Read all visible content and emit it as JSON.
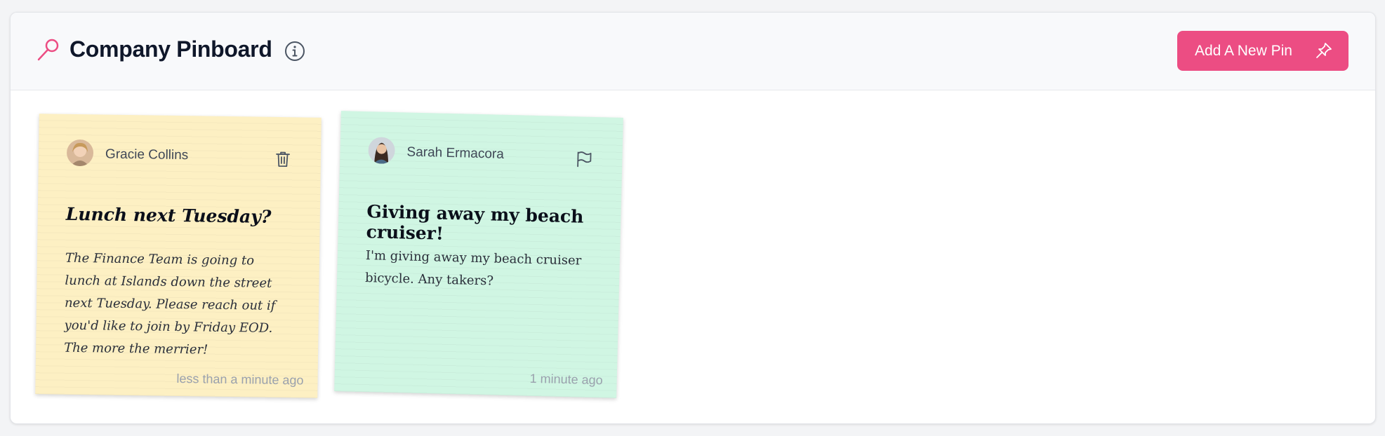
{
  "header": {
    "title": "Company Pinboard",
    "add_button_label": "Add A New Pin"
  },
  "icons": {
    "logo": "pin-icon",
    "info": "info-icon",
    "add_pin": "pushpin-icon",
    "delete": "trash-icon",
    "report": "flag-icon"
  },
  "colors": {
    "accent": "#ec4d83",
    "yellow_note": "#fdf0c3",
    "green_note": "#d0f6e3"
  },
  "notes": [
    {
      "author": "Gracie Collins",
      "title": "Lunch next Tuesday?",
      "body": "The Finance Team is going to lunch at Islands down the street next Tuesday. Please reach out if you'd like to join by Friday EOD. The more the merrier!",
      "time": "less than a minute ago",
      "action_icon": "trash-icon"
    },
    {
      "author": "Sarah Ermacora",
      "title": "Giving away my beach cruiser!",
      "body": "I'm giving away my beach cruiser bicycle. Any takers?",
      "time": "1 minute ago",
      "action_icon": "flag-icon"
    }
  ]
}
